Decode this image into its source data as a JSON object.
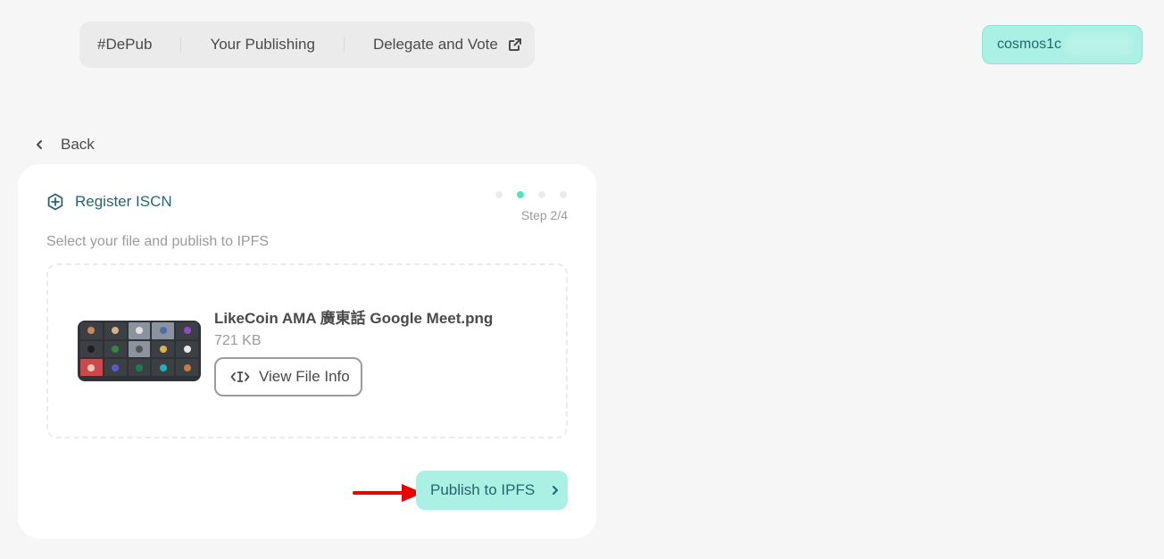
{
  "nav": {
    "items": [
      {
        "label": "#DePub"
      },
      {
        "label": "Your Publishing"
      },
      {
        "label": "Delegate and Vote",
        "icon": "external-link-icon"
      }
    ]
  },
  "wallet": {
    "address_visible": "cosmos1c"
  },
  "back": {
    "label": "Back"
  },
  "card": {
    "title": "Register ISCN",
    "step_label": "Step 2/4",
    "step_current": 2,
    "step_total": 4,
    "subtitle": "Select your file and publish to IPFS",
    "file": {
      "name": "LikeCoin AMA 廣東話 Google Meet.png",
      "size": "721 KB",
      "view_info_label": "View File Info"
    },
    "publish_label": "Publish to IPFS"
  },
  "colors": {
    "accent": "#aaf0e4",
    "accent_text": "#28646e",
    "step_active": "#50e3c2",
    "annotation_arrow": "#e80000"
  }
}
